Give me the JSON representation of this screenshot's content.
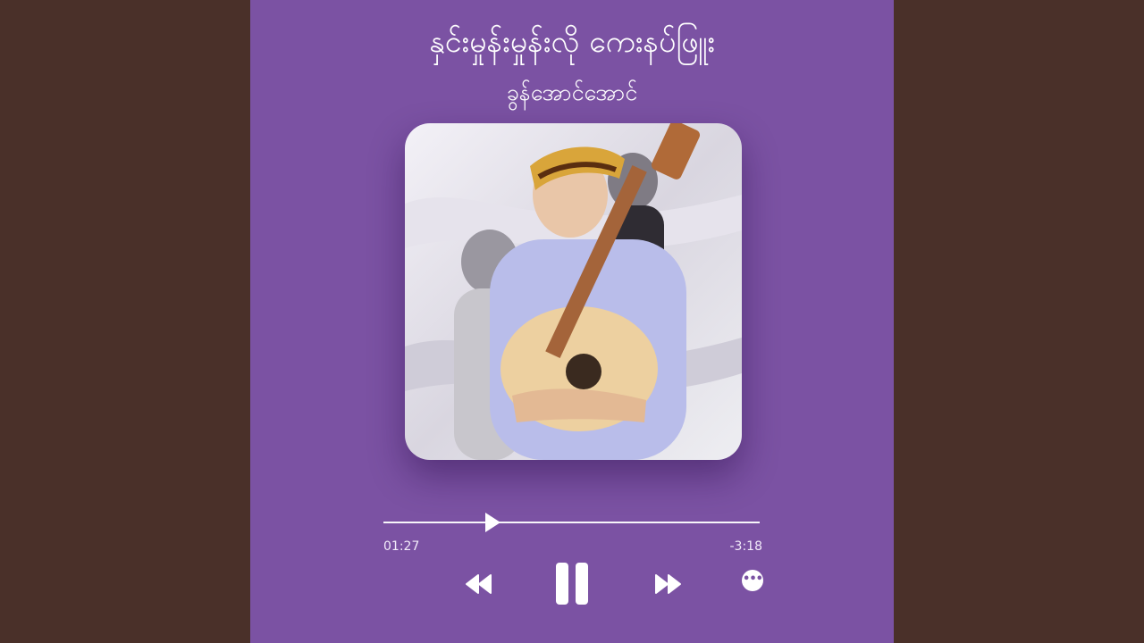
{
  "song": {
    "title": "နှင်းမှုန်းမှုန်းလို ကေးနပ်ဖြူး",
    "artist": "ခွန်အောင်အောင်"
  },
  "player": {
    "progress_fraction": 0.29,
    "elapsed": "01:27",
    "remaining": "-3:18",
    "controls": {
      "rewind_icon": "rewind-icon",
      "pause_icon": "pause-icon",
      "forward_icon": "fast-forward-icon",
      "more_icon": "more-options-icon",
      "more_glyph": "•••"
    }
  },
  "colors": {
    "panel_background": "#7b52a3",
    "side_background": "#4a3029",
    "foreground": "#ffffff"
  }
}
